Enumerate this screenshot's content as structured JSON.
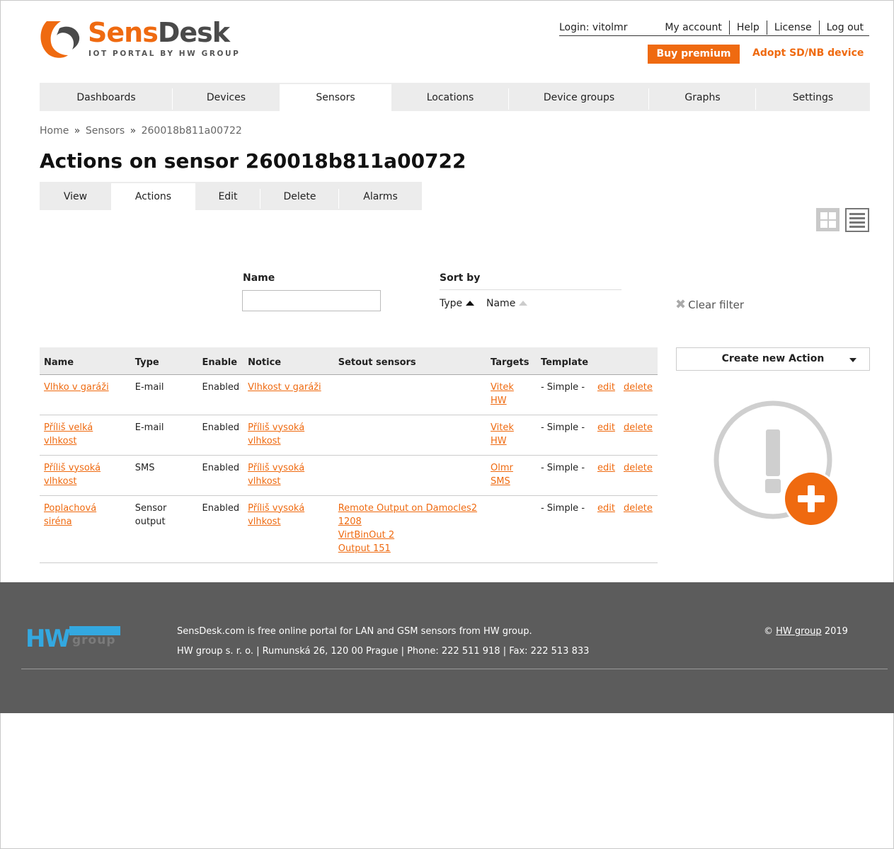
{
  "brand": {
    "name_part1": "Sens",
    "name_part2": "Desk",
    "tagline": "IOT PORTAL BY HW GROUP"
  },
  "header": {
    "login_text": "Login: vitolmr",
    "links": [
      "My account",
      "Help",
      "License",
      "Log out"
    ],
    "buy_premium": "Buy premium",
    "adopt": "Adopt SD/NB device"
  },
  "nav": {
    "items": [
      "Dashboards",
      "Devices",
      "Sensors",
      "Locations",
      "Device groups",
      "Graphs",
      "Settings"
    ],
    "active": "Sensors"
  },
  "breadcrumb": {
    "home": "Home",
    "sensors": "Sensors",
    "current": "260018b811a00722",
    "separator": "»"
  },
  "page": {
    "title": "Actions on sensor 260018b811a00722"
  },
  "subtabs": {
    "items": [
      "View",
      "Actions",
      "Edit",
      "Delete",
      "Alarms"
    ],
    "active": "Actions"
  },
  "filter": {
    "name_label": "Name",
    "name_value": "",
    "sort_label": "Sort by",
    "sort_type": "Type",
    "sort_name": "Name",
    "clear": "Clear filter"
  },
  "table": {
    "headers": [
      "Name",
      "Type",
      "Enable",
      "Notice",
      "Setout sensors",
      "Targets",
      "Template"
    ],
    "rows": [
      {
        "name": "Vlhko v garáži",
        "type": "E-mail",
        "enable": "Enabled",
        "notice": "Vlhkost v garáži",
        "setout": [],
        "targets": [
          "Vitek HW"
        ],
        "template": "- Simple -",
        "edit": "edit",
        "delete": "delete"
      },
      {
        "name": "Příliš velká vlhkost",
        "type": "E-mail",
        "enable": "Enabled",
        "notice": "Příliš vysoká vlhkost",
        "setout": [],
        "targets": [
          "Vitek HW"
        ],
        "template": "- Simple -",
        "edit": "edit",
        "delete": "delete"
      },
      {
        "name": "Příliš vysoká vlhkost",
        "type": "SMS",
        "enable": "Enabled",
        "notice": "Příliš vysoká vlhkost",
        "setout": [],
        "targets": [
          "Olmr SMS"
        ],
        "template": "- Simple -",
        "edit": "edit",
        "delete": "delete"
      },
      {
        "name": "Poplachová siréna",
        "type": "Sensor output",
        "enable": "Enabled",
        "notice": "Příliš vysoká vlhkost",
        "setout": [
          "Remote Output on Damocles2 1208",
          "VirtBinOut 2",
          "Output 151"
        ],
        "targets": [],
        "template": "- Simple -",
        "edit": "edit",
        "delete": "delete"
      }
    ]
  },
  "sidebar": {
    "create_action": "Create new Action"
  },
  "footer": {
    "line1": "SensDesk.com is free online portal for LAN and GSM sensors from HW group.",
    "line2": "HW group s. r. o. | Rumunská 26, 120 00 Prague | Phone: 222 511 918 | Fax: 222 513 833",
    "copy_symbol": "©",
    "copy_link": "HW group",
    "copy_year": "2019",
    "logo_text_hw": "HW",
    "logo_text_group": "group"
  },
  "colors": {
    "accent": "#ef6a10",
    "nav_bg": "#ececec",
    "footer_bg": "#5c5c5c"
  },
  "icons": [
    "sensdesk-logo-icon",
    "grid-view-icon",
    "list-view-icon",
    "sort-up-arrow-icon",
    "clear-x-icon",
    "dropdown-caret-icon",
    "alert-add-icon",
    "hw-group-logo-icon"
  ]
}
